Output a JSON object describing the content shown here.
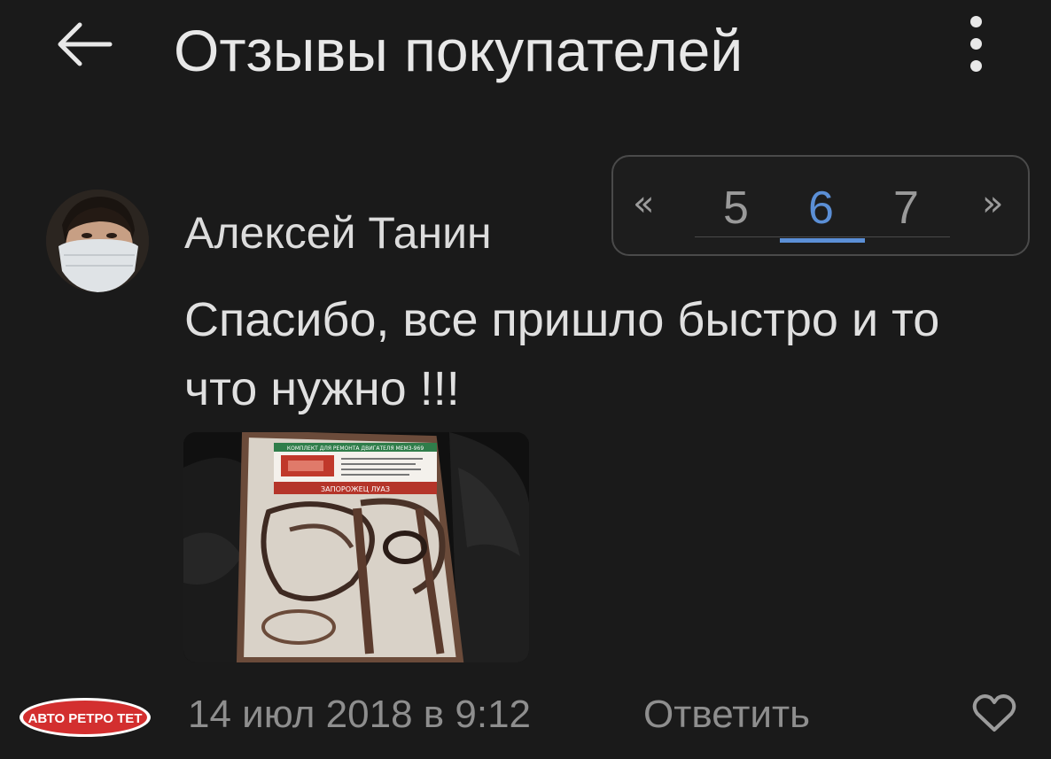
{
  "header": {
    "title": "Отзывы покупателей",
    "back_icon": "arrow-left-icon",
    "menu_icon": "more-vertical-icon"
  },
  "pagination": {
    "prev": "«",
    "next": "»",
    "pages": [
      "5",
      "6",
      "7"
    ],
    "active_page": "6",
    "accent": "#5b8fd6"
  },
  "review": {
    "author": "Алексей Танин",
    "text": "Спасибо, все пришло быстро и то что нужно !!!",
    "photo_label_top": "КОМПЛЕКТ ДЛЯ РЕМОНТА ДВИГАТЕЛЯ МЕМЗ-969",
    "photo_label_bottom": "ЗАПОРОЖЕЦ ЛУАЗ",
    "date": "14 июл 2018 в 9:12",
    "reply_label": "Ответить",
    "like_icon": "heart-outline-icon"
  },
  "badge": {
    "text": "АВТО РЕТРО ТЕТ",
    "color": "#d32f2f"
  },
  "colors": {
    "background": "#1a1a1a",
    "text": "#e6e6e6",
    "muted": "#8e8e8e"
  }
}
